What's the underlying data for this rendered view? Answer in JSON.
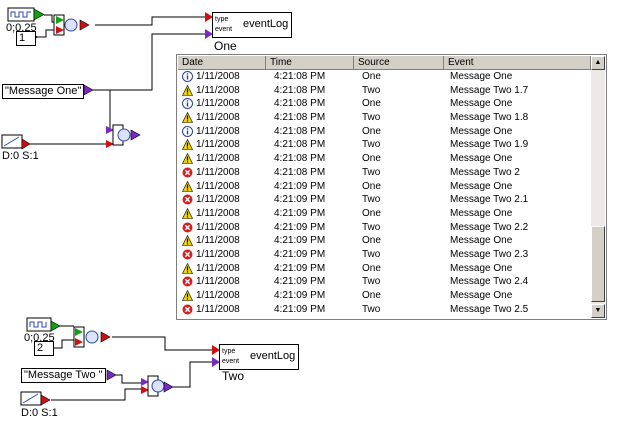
{
  "colors": {
    "info": "#2b3fa0",
    "warning": "#f2d600",
    "error": "#d42020",
    "pin_red": "#d01010",
    "pin_purple": "#7a2ac2",
    "pin_green": "#10a010"
  },
  "top_group": {
    "timer_value": "0;0.25",
    "constant_value": "1",
    "message_text": "\"Message One\"",
    "dispatcher_label": "D:0 S:1",
    "eventlog": {
      "title": "eventLog",
      "pin_type": "type",
      "pin_event": "event",
      "caption": "One"
    }
  },
  "bottom_group": {
    "timer_value": "0;0.25",
    "constant_value": "2",
    "message_text": "\"Message Two \"",
    "dispatcher_label": "D:0 S:1",
    "eventlog": {
      "title": "eventLog",
      "pin_type": "type",
      "pin_event": "event",
      "caption": "Two"
    }
  },
  "log_table": {
    "columns": [
      "Date",
      "Time",
      "Source",
      "Event"
    ],
    "rows": [
      {
        "icon": "info",
        "date": "1/11/2008",
        "time": "4:21:08 PM",
        "source": "One",
        "event": "Message One"
      },
      {
        "icon": "warning",
        "date": "1/11/2008",
        "time": "4:21:08 PM",
        "source": "Two",
        "event": "Message Two 1.7"
      },
      {
        "icon": "info",
        "date": "1/11/2008",
        "time": "4:21:08 PM",
        "source": "One",
        "event": "Message One"
      },
      {
        "icon": "warning",
        "date": "1/11/2008",
        "time": "4:21:08 PM",
        "source": "Two",
        "event": "Message Two 1.8"
      },
      {
        "icon": "info",
        "date": "1/11/2008",
        "time": "4:21:08 PM",
        "source": "One",
        "event": "Message One"
      },
      {
        "icon": "warning",
        "date": "1/11/2008",
        "time": "4:21:08 PM",
        "source": "Two",
        "event": "Message Two 1.9"
      },
      {
        "icon": "warning",
        "date": "1/11/2008",
        "time": "4:21:08 PM",
        "source": "One",
        "event": "Message One"
      },
      {
        "icon": "error",
        "date": "1/11/2008",
        "time": "4:21:08 PM",
        "source": "Two",
        "event": "Message Two 2"
      },
      {
        "icon": "warning",
        "date": "1/11/2008",
        "time": "4:21:09 PM",
        "source": "One",
        "event": "Message One"
      },
      {
        "icon": "error",
        "date": "1/11/2008",
        "time": "4:21:09 PM",
        "source": "Two",
        "event": "Message Two 2.1"
      },
      {
        "icon": "warning",
        "date": "1/11/2008",
        "time": "4:21:09 PM",
        "source": "One",
        "event": "Message One"
      },
      {
        "icon": "error",
        "date": "1/11/2008",
        "time": "4:21:09 PM",
        "source": "Two",
        "event": "Message Two 2.2"
      },
      {
        "icon": "warning",
        "date": "1/11/2008",
        "time": "4:21:09 PM",
        "source": "One",
        "event": "Message One"
      },
      {
        "icon": "error",
        "date": "1/11/2008",
        "time": "4:21:09 PM",
        "source": "Two",
        "event": "Message Two 2.3"
      },
      {
        "icon": "warning",
        "date": "1/11/2008",
        "time": "4:21:09 PM",
        "source": "One",
        "event": "Message One"
      },
      {
        "icon": "error",
        "date": "1/11/2008",
        "time": "4:21:09 PM",
        "source": "Two",
        "event": "Message Two 2.4"
      },
      {
        "icon": "warning",
        "date": "1/11/2008",
        "time": "4:21:09 PM",
        "source": "One",
        "event": "Message One"
      },
      {
        "icon": "error",
        "date": "1/11/2008",
        "time": "4:21:09 PM",
        "source": "Two",
        "event": "Message Two 2.5"
      }
    ]
  }
}
